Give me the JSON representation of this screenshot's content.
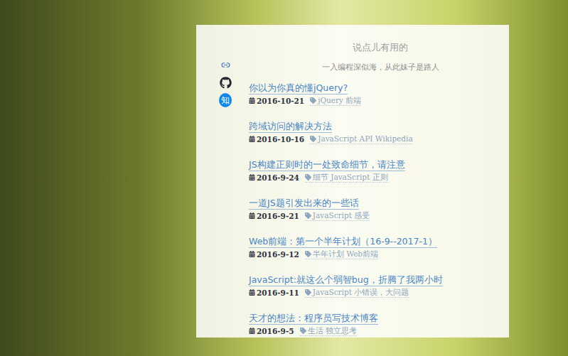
{
  "blog": {
    "title": "说点儿有用的",
    "subtitle": "一入编程深似海，从此妹子是路人"
  },
  "sidebar": {
    "links": [
      {
        "kind": "link"
      },
      {
        "kind": "github"
      },
      {
        "kind": "zhihu",
        "label": "知"
      }
    ]
  },
  "posts": [
    {
      "title": "你以为你真的懂jQuery?",
      "date": "2016-10-21",
      "tags": "jQuery 前端"
    },
    {
      "title": "跨域访问的解决方法",
      "date": "2016-10-16",
      "tags": "JavaScript API Wikipedia"
    },
    {
      "title": "JS构建正则时的一处致命细节，请注意",
      "date": "2016-9-24",
      "tags": "细节 JavaScript 正则"
    },
    {
      "title": "一道JS题引发出来的一些话",
      "date": "2016-9-21",
      "tags": "JavaScript 感受"
    },
    {
      "title": "Web前端：第一个半年计划（16-9--2017-1）",
      "date": "2016-9-12",
      "tags": "半年计划 Web前端"
    },
    {
      "title": "JavaScript:就这么个弱智bug，折腾了我两小时",
      "date": "2016-9-11",
      "tags": "JavaScript 小错误，大问题"
    },
    {
      "title": "天才的想法：程序员写技术博客",
      "date": "2016-9-5",
      "tags": "生活 独立思考"
    }
  ]
}
